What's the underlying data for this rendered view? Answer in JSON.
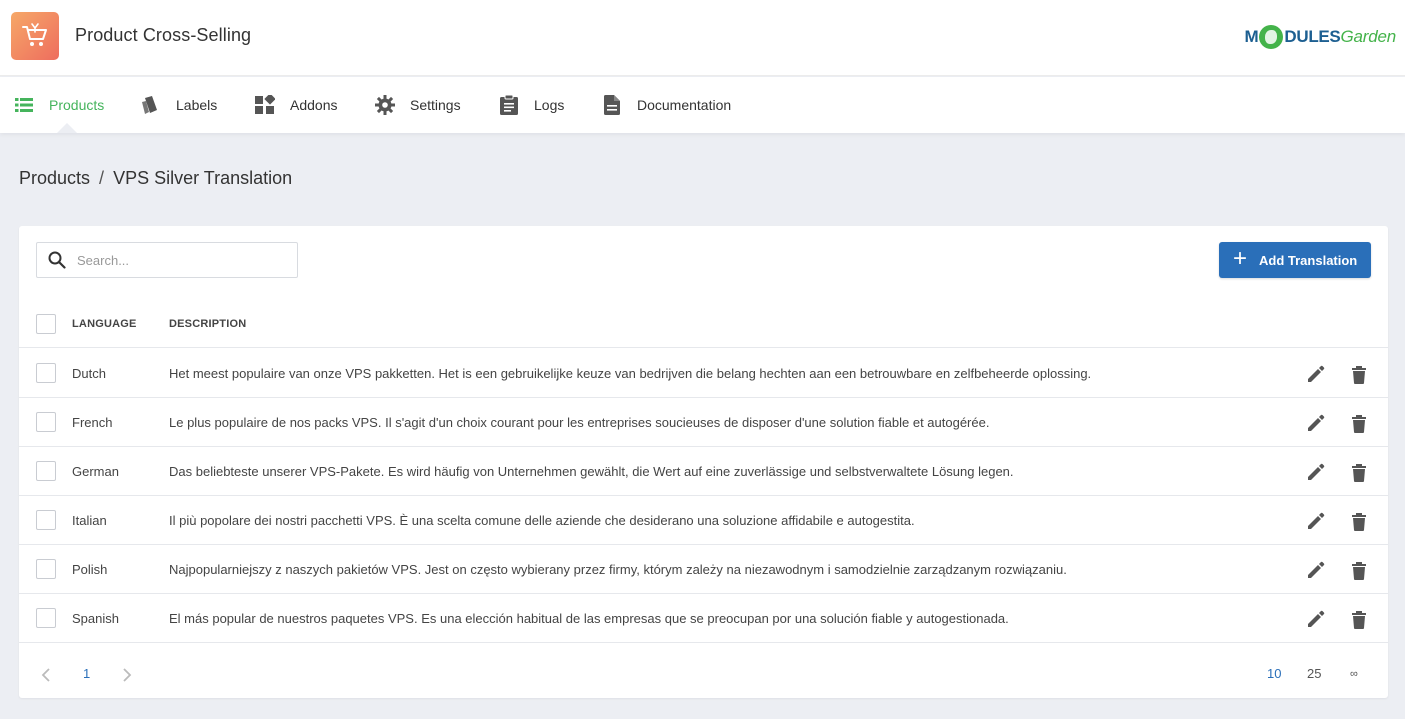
{
  "app": {
    "title": "Product Cross-Selling"
  },
  "brand": {
    "part1": "M",
    "part2": "DULES",
    "part3": "Garden"
  },
  "nav": {
    "items": [
      {
        "label": "Products",
        "icon": "list-icon",
        "active": true
      },
      {
        "label": "Labels",
        "icon": "tags-icon",
        "active": false
      },
      {
        "label": "Addons",
        "icon": "widgets-icon",
        "active": false
      },
      {
        "label": "Settings",
        "icon": "gear-icon",
        "active": false
      },
      {
        "label": "Logs",
        "icon": "clipboard-icon",
        "active": false
      },
      {
        "label": "Documentation",
        "icon": "document-icon",
        "active": false
      }
    ]
  },
  "breadcrumb": {
    "parent": "Products",
    "separator": "/",
    "current": "VPS Silver Translation"
  },
  "toolbar": {
    "search_placeholder": "Search...",
    "add_label": "Add Translation"
  },
  "table": {
    "columns": [
      "LANGUAGE",
      "DESCRIPTION"
    ],
    "rows": [
      {
        "language": "Dutch",
        "description": "Het meest populaire van onze VPS pakketten. Het is een gebruikelijke keuze van bedrijven die belang hechten aan een betrouwbare en zelfbeheerde oplossing."
      },
      {
        "language": "French",
        "description": "Le plus populaire de nos packs VPS. Il s'agit d'un choix courant pour les entreprises soucieuses de disposer d'une solution fiable et autogérée."
      },
      {
        "language": "German",
        "description": "Das beliebteste unserer VPS-Pakete. Es wird häufig von Unternehmen gewählt, die Wert auf eine zuverlässige und selbstverwaltete Lösung legen."
      },
      {
        "language": "Italian",
        "description": "Il più popolare dei nostri pacchetti VPS. È una scelta comune delle aziende che desiderano una soluzione affidabile e autogestita."
      },
      {
        "language": "Polish",
        "description": "Najpopularniejszy z naszych pakietów VPS. Jest on często wybierany przez firmy, którym zależy na niezawodnym i samodzielnie zarządzanym rozwiązaniu."
      },
      {
        "language": "Spanish",
        "description": "El más popular de nuestros paquetes VPS. Es una elección habitual de las empresas que se preocupan por una solución fiable y autogestionada."
      }
    ]
  },
  "pagination": {
    "current_page": "1",
    "page_sizes": [
      "10",
      "25",
      "∞"
    ],
    "selected_size": "10"
  },
  "colors": {
    "accent_green": "#45b45c",
    "primary_blue": "#2a6fb9"
  }
}
